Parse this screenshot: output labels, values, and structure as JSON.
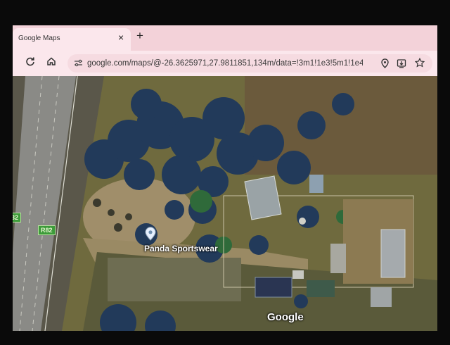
{
  "browser": {
    "tab": {
      "title": "Google Maps",
      "close_glyph": "×"
    },
    "new_tab_glyph": "+",
    "toolbar": {
      "reload_icon": "reload-icon",
      "home_icon": "home-icon",
      "site_info_icon": "tune-icon",
      "url": "google.com/maps/@-26.3625971,27.9811851,134m/data=!3m1!1e3!5m1!1e4?entry...",
      "right_icons": [
        "location-icon",
        "install-app-icon",
        "star-icon"
      ]
    }
  },
  "map": {
    "view": "satellite",
    "place_label": "Panda Sportswear",
    "route_label": "R82",
    "route_label_partial": "32",
    "logo": "Google",
    "colors": {
      "road": "#8a8a8a",
      "field": "#7a7242",
      "trees": "#223a5a",
      "roof": "#9aa3a6"
    }
  }
}
